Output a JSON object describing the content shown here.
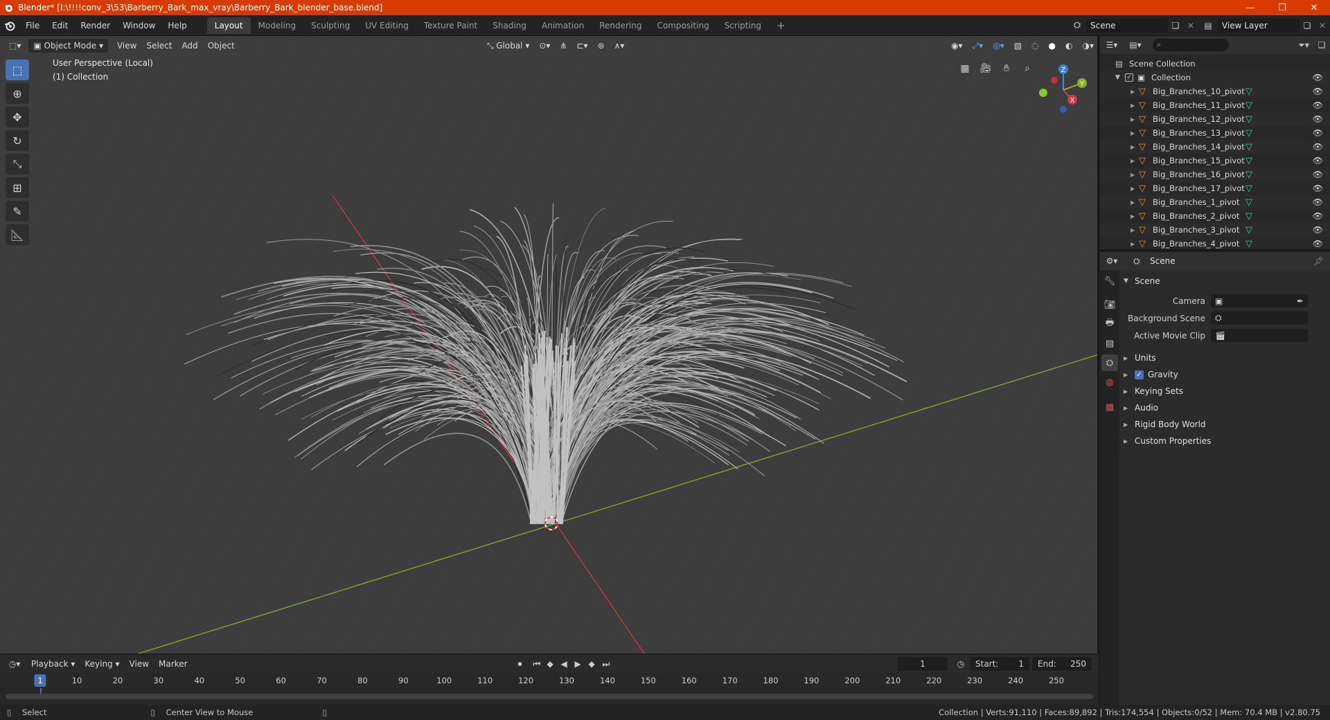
{
  "window": {
    "title": "Blender* [I:\\!!!!conv_3\\53\\Barberry_Bark_max_vray\\Barberry_Bark_blender_base.blend]",
    "minimize": "—",
    "restore": "❐",
    "close": "✕"
  },
  "menu": [
    "File",
    "Edit",
    "Render",
    "Window",
    "Help"
  ],
  "workspaces": [
    "Layout",
    "Modeling",
    "Sculpting",
    "UV Editing",
    "Texture Paint",
    "Shading",
    "Animation",
    "Rendering",
    "Compositing",
    "Scripting"
  ],
  "active_workspace": "Layout",
  "add_workspace": "+",
  "scene_name": "Scene",
  "view_layer": "View Layer",
  "viewport": {
    "mode": "Object Mode",
    "menus": [
      "View",
      "Select",
      "Add",
      "Object"
    ],
    "transform_orientation": "Global",
    "overlay_title": "User Perspective (Local)",
    "overlay_collection": "(1) Collection",
    "gizmo": {
      "x": "X",
      "y": "Y",
      "z": "Z"
    }
  },
  "outliner": {
    "root": "Scene Collection",
    "collection": "Collection",
    "items": [
      "Big_Branches_10_pivot",
      "Big_Branches_11_pivot",
      "Big_Branches_12_pivot",
      "Big_Branches_13_pivot",
      "Big_Branches_14_pivot",
      "Big_Branches_15_pivot",
      "Big_Branches_16_pivot",
      "Big_Branches_17_pivot",
      "Big_Branches_1_pivot",
      "Big_Branches_2_pivot",
      "Big_Branches_3_pivot",
      "Big_Branches_4_pivot"
    ]
  },
  "properties": {
    "header": "Scene",
    "section": "Scene",
    "fields": [
      {
        "label": "Camera"
      },
      {
        "label": "Background Scene"
      },
      {
        "label": "Active Movie Clip"
      }
    ],
    "subsections": [
      "Units",
      "Gravity",
      "Keying Sets",
      "Audio",
      "Rigid Body World",
      "Custom Properties"
    ]
  },
  "timeline": {
    "menus": [
      "Playback",
      "Keying",
      "View",
      "Marker"
    ],
    "current_frame": "1",
    "start_label": "Start:",
    "start": "1",
    "end_label": "End:",
    "end": "250",
    "ticks": [
      "1",
      "10",
      "20",
      "30",
      "40",
      "50",
      "60",
      "70",
      "80",
      "90",
      "100",
      "110",
      "120",
      "130",
      "140",
      "150",
      "160",
      "170",
      "180",
      "190",
      "200",
      "210",
      "220",
      "230",
      "240",
      "250"
    ]
  },
  "status": {
    "left": "Select",
    "middle": "Center View to Mouse",
    "right": "Collection | Verts:91,110 | Faces:89,892 | Tris:174,554 | Objects:0/52 | Mem: 70.4 MB | v2.80.75"
  },
  "colors": {
    "titlebar": "#d83b01",
    "accent": "#4772b3",
    "x_axis": "#c8383e",
    "y_axis": "#7fa82a",
    "object_icon": "#e8923a",
    "mesh_icon": "#3ec9a0"
  }
}
